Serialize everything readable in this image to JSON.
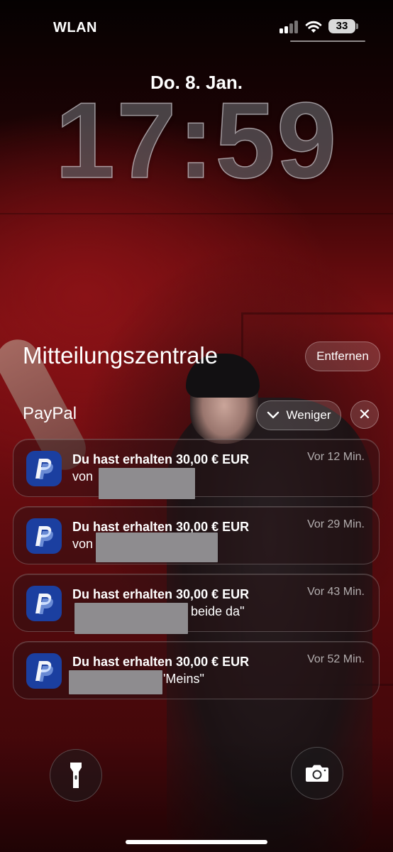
{
  "status_bar": {
    "carrier": "WLAN",
    "battery_level": "33"
  },
  "lock_screen": {
    "date": "Do. 8. Jan.",
    "time": "17:59"
  },
  "notification_center": {
    "title": "Mitteilungszentrale",
    "remove_label": "Entfernen",
    "group": {
      "app_name": "PayPal",
      "less_label": "Weniger",
      "close_symbol": "✕"
    },
    "notifications": [
      {
        "title": "Du hast erhalten 30,00 € EUR",
        "time": "Vor 12 Min.",
        "body_prefix": "von",
        "body_suffix": ""
      },
      {
        "title": "Du hast erhalten 30,00 € EUR",
        "time": "Vor 29 Min.",
        "body_prefix": "von",
        "body_suffix": ""
      },
      {
        "title": "Du hast erhalten 30,00 € EUR",
        "time": "Vor 43 Min.",
        "body_prefix": "",
        "body_suffix": "beide da\""
      },
      {
        "title": "Du hast erhalten 30,00 € EUR",
        "time": "Vor 52 Min.",
        "body_prefix": "",
        "body_suffix": "'Meins\""
      }
    ]
  },
  "icons": {
    "app_icon": "paypal-logo-icon",
    "flashlight": "flashlight-icon",
    "camera": "camera-icon",
    "chevron": "chevron-down-icon"
  },
  "colors": {
    "paypal_blue": "#1b3fa0",
    "background_red": "#7a0f12"
  }
}
